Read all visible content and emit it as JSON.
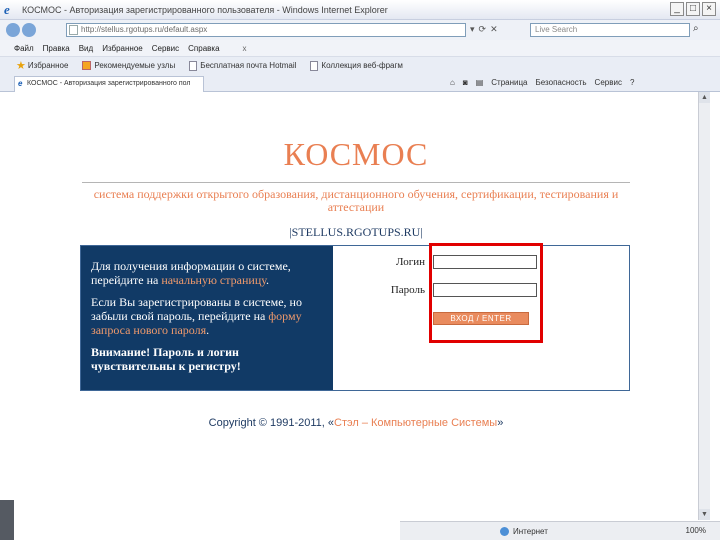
{
  "window": {
    "title": "КОСМОС - Авторизация зарегистрированного пользователя - Windows Internet Explorer",
    "address": "http://stellus.rgotups.ru/default.aspx",
    "search_placeholder": "Live Search",
    "buttons": {
      "minimize": "_",
      "maximize": "□",
      "close": "×"
    }
  },
  "menu": {
    "items": [
      "Файл",
      "Правка",
      "Вид",
      "Избранное",
      "Сервис",
      "Справка"
    ],
    "close_x": "x"
  },
  "favorites": {
    "label": "Избранное",
    "items": [
      "Рекомендуемые узлы",
      "Бесплатная почта Hotmail",
      "Коллекция веб-фрагм"
    ]
  },
  "tab": {
    "label": "КОСМОС - Авторизация зарегистрированного пол"
  },
  "command_bar": {
    "items": [
      "Страница",
      "Безопасность",
      "Сервис"
    ]
  },
  "page": {
    "logo": "КОСМОС",
    "subtitle": "система поддержки открытого образования, дистанционного обучения, сертификации, тестирования и аттестации",
    "site": "|STELLUS.RGOTUPS.RU|",
    "info": {
      "p1_text": "Для получения информации о системе, перейдите на ",
      "p1_link": "начальную страницу",
      "p1_end": ".",
      "p2_text": "Если Вы зарегистрированы в системе, но забыли свой пароль, перейдите на ",
      "p2_link": "форму запроса нового пароля",
      "p2_end": ".",
      "warning": "Внимание! Пароль и логин чувствительны к регистру!"
    },
    "form": {
      "login_label": "Логин",
      "password_label": "Пароль",
      "login_value": "",
      "password_value": "",
      "submit_label": "ВХОД / ENTER"
    },
    "copyright_text": "Copyright © 1991-2011, «",
    "copyright_brand": "Стэл – Компьютерные Системы",
    "copyright_end": "»"
  },
  "status": {
    "zone": "Интернет",
    "zoom": "100%"
  },
  "colors": {
    "accent": "#e97f52",
    "panel": "#113a66",
    "highlight": "#e10000"
  }
}
